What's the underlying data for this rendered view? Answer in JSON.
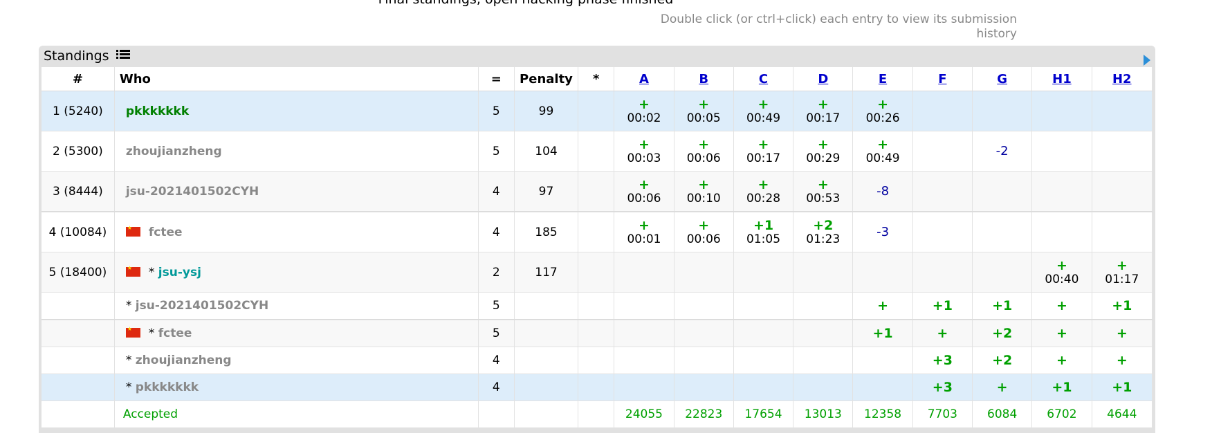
{
  "page": {
    "title": "Final standings, open hacking phase finished",
    "hint": "Double click (or ctrl+click) each entry to view its submission history"
  },
  "panel": {
    "title": "Standings"
  },
  "columns": {
    "rank": "#",
    "who": "Who",
    "solved": "=",
    "penalty": "Penalty",
    "hacks": "*",
    "problems": [
      "A",
      "B",
      "C",
      "D",
      "E",
      "F",
      "G",
      "H1",
      "H2"
    ]
  },
  "rows": [
    {
      "rank": "1 (5240)",
      "who": "pkkkkkkk",
      "flag": false,
      "star": false,
      "solved": "5",
      "penalty": "99",
      "cells": [
        {
          "t": "acc",
          "v": "+",
          "time": "00:02"
        },
        {
          "t": "acc",
          "v": "+",
          "time": "00:05"
        },
        {
          "t": "acc",
          "v": "+",
          "time": "00:49"
        },
        {
          "t": "acc",
          "v": "+",
          "time": "00:17"
        },
        {
          "t": "acc",
          "v": "+",
          "time": "00:26"
        },
        {
          "t": "empty",
          "v": ""
        },
        {
          "t": "empty",
          "v": ""
        },
        {
          "t": "empty",
          "v": ""
        },
        {
          "t": "empty",
          "v": ""
        }
      ]
    },
    {
      "rank": "2 (5300)",
      "who": "zhoujianzheng",
      "flag": false,
      "star": false,
      "solved": "5",
      "penalty": "104",
      "cells": [
        {
          "t": "acc",
          "v": "+",
          "time": "00:03"
        },
        {
          "t": "acc",
          "v": "+",
          "time": "00:06"
        },
        {
          "t": "acc",
          "v": "+",
          "time": "00:17"
        },
        {
          "t": "acc",
          "v": "+",
          "time": "00:29"
        },
        {
          "t": "acc",
          "v": "+",
          "time": "00:49"
        },
        {
          "t": "empty",
          "v": ""
        },
        {
          "t": "neg",
          "v": "-2"
        },
        {
          "t": "empty",
          "v": ""
        },
        {
          "t": "empty",
          "v": ""
        }
      ]
    },
    {
      "rank": "3 (8444)",
      "who": "jsu-2021401502CYH",
      "flag": false,
      "star": false,
      "solved": "4",
      "penalty": "97",
      "cells": [
        {
          "t": "acc",
          "v": "+",
          "time": "00:06"
        },
        {
          "t": "acc",
          "v": "+",
          "time": "00:10"
        },
        {
          "t": "acc",
          "v": "+",
          "time": "00:28"
        },
        {
          "t": "acc",
          "v": "+",
          "time": "00:53"
        },
        {
          "t": "neg",
          "v": "-8"
        },
        {
          "t": "empty",
          "v": ""
        },
        {
          "t": "empty",
          "v": ""
        },
        {
          "t": "empty",
          "v": ""
        },
        {
          "t": "empty",
          "v": ""
        }
      ]
    },
    {
      "rank": "4 (10084)",
      "who": "fctee",
      "flag": true,
      "star": false,
      "solved": "4",
      "penalty": "185",
      "cells": [
        {
          "t": "acc",
          "v": "+",
          "time": "00:01"
        },
        {
          "t": "acc",
          "v": "+",
          "time": "00:06"
        },
        {
          "t": "acc",
          "v": "+1",
          "time": "01:05"
        },
        {
          "t": "acc",
          "v": "+2",
          "time": "01:23"
        },
        {
          "t": "neg",
          "v": "-3"
        },
        {
          "t": "empty",
          "v": ""
        },
        {
          "t": "empty",
          "v": ""
        },
        {
          "t": "empty",
          "v": ""
        },
        {
          "t": "empty",
          "v": ""
        }
      ]
    },
    {
      "rank": "5 (18400)",
      "who": "jsu-ysj",
      "flag": true,
      "star": true,
      "solved": "2",
      "penalty": "117",
      "cells": [
        {
          "t": "empty",
          "v": ""
        },
        {
          "t": "empty",
          "v": ""
        },
        {
          "t": "empty",
          "v": ""
        },
        {
          "t": "empty",
          "v": ""
        },
        {
          "t": "empty",
          "v": ""
        },
        {
          "t": "empty",
          "v": ""
        },
        {
          "t": "empty",
          "v": ""
        },
        {
          "t": "acc",
          "v": "+",
          "time": "00:40"
        },
        {
          "t": "acc",
          "v": "+",
          "time": "01:17"
        }
      ]
    },
    {
      "rank": "",
      "who": "jsu-2021401502CYH",
      "flag": false,
      "star": true,
      "solved": "5",
      "penalty": "",
      "cells": [
        {
          "t": "empty",
          "v": ""
        },
        {
          "t": "empty",
          "v": ""
        },
        {
          "t": "empty",
          "v": ""
        },
        {
          "t": "empty",
          "v": ""
        },
        {
          "t": "plain",
          "v": "+"
        },
        {
          "t": "plain",
          "v": "+1"
        },
        {
          "t": "plain",
          "v": "+1"
        },
        {
          "t": "plain",
          "v": "+"
        },
        {
          "t": "plain",
          "v": "+1"
        }
      ]
    },
    {
      "rank": "",
      "who": "fctee",
      "flag": true,
      "star": true,
      "solved": "5",
      "penalty": "",
      "cells": [
        {
          "t": "empty",
          "v": ""
        },
        {
          "t": "empty",
          "v": ""
        },
        {
          "t": "empty",
          "v": ""
        },
        {
          "t": "empty",
          "v": ""
        },
        {
          "t": "plain",
          "v": "+1"
        },
        {
          "t": "plain",
          "v": "+"
        },
        {
          "t": "plain",
          "v": "+2"
        },
        {
          "t": "plain",
          "v": "+"
        },
        {
          "t": "plain",
          "v": "+"
        }
      ]
    },
    {
      "rank": "",
      "who": "zhoujianzheng",
      "flag": false,
      "star": true,
      "solved": "4",
      "penalty": "",
      "cells": [
        {
          "t": "empty",
          "v": ""
        },
        {
          "t": "empty",
          "v": ""
        },
        {
          "t": "empty",
          "v": ""
        },
        {
          "t": "empty",
          "v": ""
        },
        {
          "t": "empty",
          "v": ""
        },
        {
          "t": "plain",
          "v": "+3"
        },
        {
          "t": "plain",
          "v": "+2"
        },
        {
          "t": "plain",
          "v": "+"
        },
        {
          "t": "plain",
          "v": "+"
        }
      ]
    },
    {
      "rank": "",
      "who": "pkkkkkkk",
      "flag": false,
      "star": true,
      "solved": "4",
      "penalty": "",
      "cells": [
        {
          "t": "empty",
          "v": ""
        },
        {
          "t": "empty",
          "v": ""
        },
        {
          "t": "empty",
          "v": ""
        },
        {
          "t": "empty",
          "v": ""
        },
        {
          "t": "empty",
          "v": ""
        },
        {
          "t": "plain",
          "v": "+3"
        },
        {
          "t": "plain",
          "v": "+"
        },
        {
          "t": "plain",
          "v": "+1"
        },
        {
          "t": "plain",
          "v": "+1"
        }
      ]
    }
  ],
  "stats": {
    "label": "Accepted",
    "values": [
      "24055",
      "22823",
      "17654",
      "13013",
      "12358",
      "7703",
      "6084",
      "6702",
      "4644"
    ]
  },
  "colors": {
    "accepted": "#00a000",
    "rejected": "#0000a0",
    "highlight": "#ddedfa",
    "link": "#0000cc"
  },
  "icons": {
    "list": "list-icon",
    "expand": "triangle-right-icon",
    "flag": "china-flag-icon"
  }
}
